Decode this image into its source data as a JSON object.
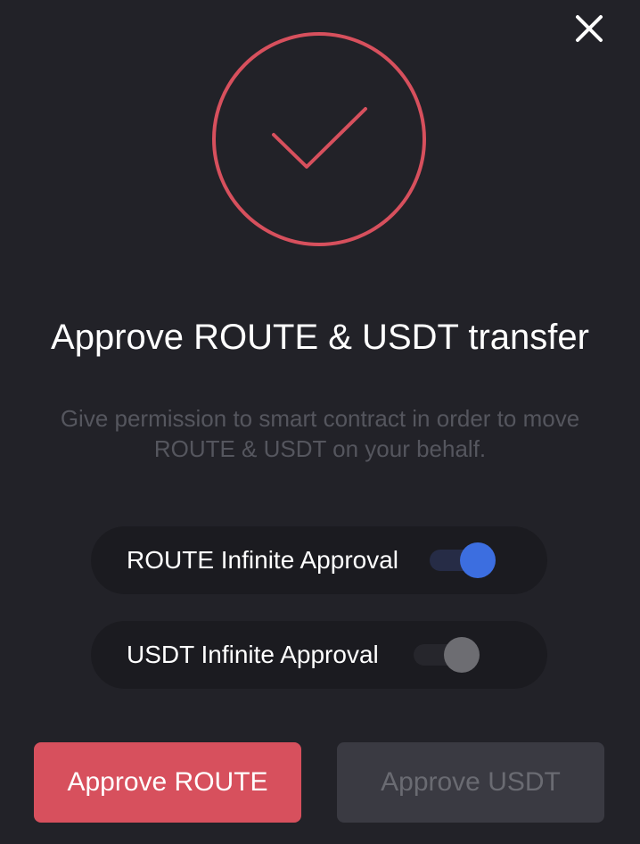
{
  "modal": {
    "title": "Approve ROUTE & USDT transfer",
    "description": "Give permission to smart contract in order to move ROUTE & USDT on your behalf.",
    "close_icon": "close-icon",
    "status_icon": "checkmark-circle-icon",
    "colors": {
      "background": "#222228",
      "accent": "#d7505d",
      "toggle_on": "#3c6ee0",
      "toggle_off": "#6d6d72",
      "muted_text": "#55565e"
    }
  },
  "toggles": [
    {
      "label": "ROUTE Infinite Approval",
      "enabled": true
    },
    {
      "label": "USDT Infinite Approval",
      "enabled": false
    }
  ],
  "buttons": {
    "approve_route": {
      "label": "Approve ROUTE",
      "enabled": true
    },
    "approve_usdt": {
      "label": "Approve USDT",
      "enabled": false
    }
  }
}
